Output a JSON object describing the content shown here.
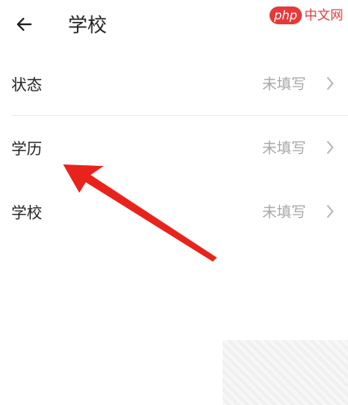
{
  "header": {
    "title": "学校",
    "back_icon": "arrow-left-icon"
  },
  "watermark": {
    "logo_text": "php",
    "site_text": "中文网"
  },
  "rows": [
    {
      "label": "状态",
      "value": "未填写"
    },
    {
      "label": "学历",
      "value": "未填写"
    },
    {
      "label": "学校",
      "value": "未填写"
    }
  ],
  "colors": {
    "annotation_arrow": "#e8231c",
    "value_text": "#a7a7a7",
    "divider": "#ececec"
  }
}
